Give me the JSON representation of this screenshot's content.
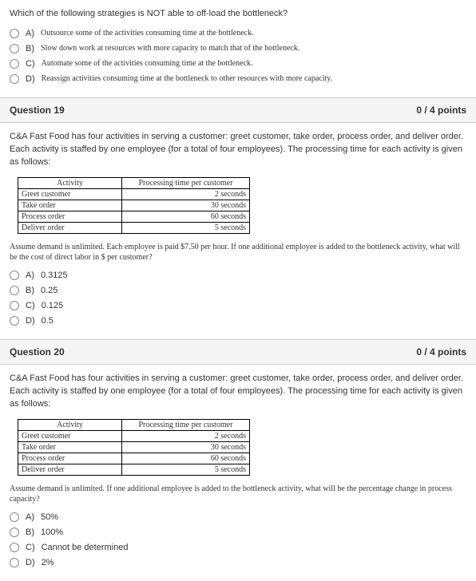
{
  "q18": {
    "stem": "Which of the following strategies is NOT able to off-load the bottleneck?",
    "options": [
      {
        "letter": "A)",
        "text": "Outsource some of the activities consuming time at the bottleneck."
      },
      {
        "letter": "B)",
        "text": "Slow down work at resources with more capacity to match that of the bottleneck."
      },
      {
        "letter": "C)",
        "text": "Automate some of the activities consuming time at the bottleneck."
      },
      {
        "letter": "D)",
        "text": "Reassign activities consuming time at the bottleneck to other resources with more capacity."
      }
    ]
  },
  "q19": {
    "title": "Question 19",
    "points": "0 / 4 points",
    "stem": "C&A Fast Food has four activities in serving a customer: greet customer, take order, process order, and deliver order. Each activity is staffed by one employee (for a total of four employees). The processing time for each activity is given as follows:",
    "table": {
      "h1": "Activity",
      "h2": "Processing time per customer",
      "rows": [
        {
          "a": "Greet customer",
          "t": "2 seconds"
        },
        {
          "a": "Take order",
          "t": "30 seconds"
        },
        {
          "a": "Process order",
          "t": "60 seconds"
        },
        {
          "a": "Deliver order",
          "t": "5 seconds"
        }
      ]
    },
    "note": "Assume demand is unlimited. Each employee is paid $7.50 per hour. If one additional employee is added to the bottleneck activity, what will be the cost of direct labor in $ per customer?",
    "options": [
      {
        "letter": "A)",
        "text": "0.3125"
      },
      {
        "letter": "B)",
        "text": "0.25"
      },
      {
        "letter": "C)",
        "text": "0.125"
      },
      {
        "letter": "D)",
        "text": "0.5"
      }
    ]
  },
  "q20": {
    "title": "Question 20",
    "points": "0 / 4 points",
    "stem": "C&A Fast Food has four activities in serving a customer: greet customer, take order, process order, and deliver order. Each activity is staffed by one employee (for a total of four employees). The processing time for each activity is given as follows:",
    "table": {
      "h1": "Activity",
      "h2": "Processing time per customer",
      "rows": [
        {
          "a": "Greet customer",
          "t": "2 seconds"
        },
        {
          "a": "Take order",
          "t": "30 seconds"
        },
        {
          "a": "Process order",
          "t": "60 seconds"
        },
        {
          "a": "Deliver order",
          "t": "5 seconds"
        }
      ]
    },
    "note": "Assume demand is unlimited. If one additional employee is added to the bottleneck activity, what will be the percentage change in process capacity?",
    "options": [
      {
        "letter": "A)",
        "text": "50%"
      },
      {
        "letter": "B)",
        "text": "100%"
      },
      {
        "letter": "C)",
        "text": "Cannot be determined"
      },
      {
        "letter": "D)",
        "text": "2%"
      }
    ]
  }
}
